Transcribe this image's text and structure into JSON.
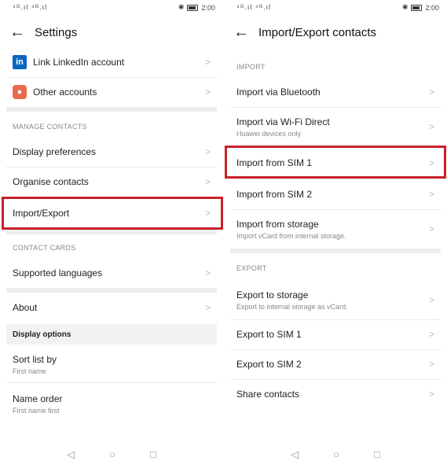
{
  "status": {
    "time": "2:00",
    "signal": "⁴ᴳ.ıl ⁴ᴳ.ıl"
  },
  "left": {
    "title": "Settings",
    "accounts": [
      {
        "label": "Link LinkedIn account",
        "icon": "linkedin-icon"
      },
      {
        "label": "Other accounts",
        "icon": "accounts-icon"
      }
    ],
    "manage_section": "MANAGE CONTACTS",
    "manage": [
      "Display preferences",
      "Organise contacts",
      "Import/Export"
    ],
    "cards_section": "CONTACT CARDS",
    "cards": [
      "Supported languages"
    ],
    "about": "About",
    "display_options": "Display options",
    "sort": {
      "label": "Sort list by",
      "sub": "First name"
    },
    "name_order": {
      "label": "Name order",
      "sub": "First name first"
    }
  },
  "right": {
    "title": "Import/Export contacts",
    "import_section": "IMPORT",
    "import": [
      {
        "label": "Import via Bluetooth",
        "sub": ""
      },
      {
        "label": "Import via Wi-Fi Direct",
        "sub": "Huawei devices only"
      },
      {
        "label": "Import from SIM 1",
        "sub": ""
      },
      {
        "label": "Import from SIM 2",
        "sub": ""
      },
      {
        "label": "Import from storage",
        "sub": "Import vCard from internal storage."
      }
    ],
    "export_section": "EXPORT",
    "export": [
      {
        "label": "Export to storage",
        "sub": "Export to internal storage as vCard."
      },
      {
        "label": "Export to SIM 1",
        "sub": ""
      },
      {
        "label": "Export to SIM 2",
        "sub": ""
      },
      {
        "label": "Share contacts",
        "sub": ""
      }
    ]
  },
  "colors": {
    "highlight": "#c8202a",
    "linkedin": "#0a66c2"
  }
}
